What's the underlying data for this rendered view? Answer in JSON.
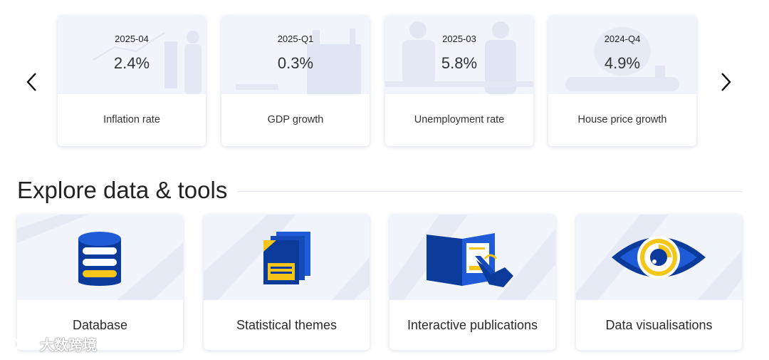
{
  "indicators": [
    {
      "period": "2025-04",
      "value": "2.4%",
      "label": "Inflation rate"
    },
    {
      "period": "2025-Q1",
      "value": "0.3%",
      "label": "GDP growth"
    },
    {
      "period": "2025-03",
      "value": "5.8%",
      "label": "Unemployment rate"
    },
    {
      "period": "2024-Q4",
      "value": "4.9%",
      "label": "House price growth"
    }
  ],
  "section": {
    "title": "Explore data & tools"
  },
  "tools": [
    {
      "label": "Database",
      "icon": "database-icon"
    },
    {
      "label": "Statistical themes",
      "icon": "documents-icon"
    },
    {
      "label": "Interactive publications",
      "icon": "touch-publication-icon"
    },
    {
      "label": "Data visualisations",
      "icon": "eye-chart-icon"
    }
  ],
  "colors": {
    "accent_blue": "#0a3a9a",
    "accent_yellow": "#f5c518",
    "card_top": "#f1f4fb"
  },
  "watermark": {
    "text": "大数跨境"
  }
}
